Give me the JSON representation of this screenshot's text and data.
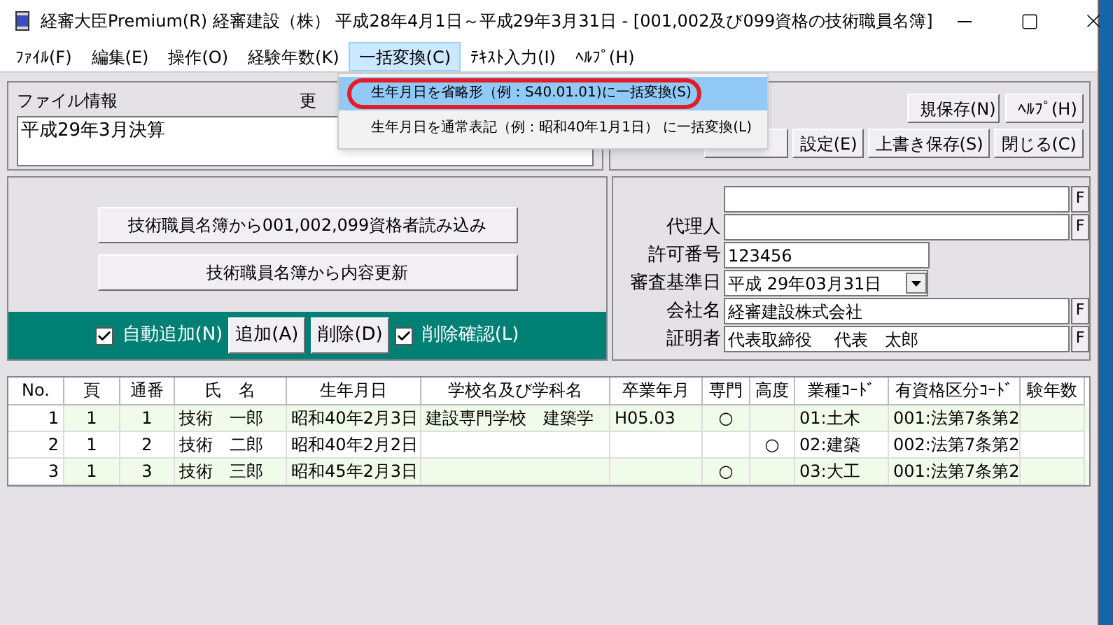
{
  "window": {
    "title": "経審大臣Premium(R)  経審建設（株）   平成28年4月1日～平成29年3月31日 - [001,002及び099資格の技術職員名簿]"
  },
  "menu": [
    {
      "label": "ﾌｧｲﾙ(F)",
      "selected": false
    },
    {
      "label": "編集(E)",
      "selected": false
    },
    {
      "label": "操作(O)",
      "selected": false
    },
    {
      "label": "経験年数(K)",
      "selected": false
    },
    {
      "label": "一括変換(C)",
      "selected": true
    },
    {
      "label": "ﾃｷｽﾄ入力(I)",
      "selected": false
    },
    {
      "label": "ﾍﾙﾌﾟ(H)",
      "selected": false
    }
  ],
  "dropdown": [
    {
      "label": "生年月日を省略形（例：S40.01.01)に一括変換(S)",
      "selected": true,
      "circled": true
    },
    {
      "label": "生年月日を通常表記（例：昭和40年1月1日） に一括変換(L)",
      "selected": false,
      "circled": false
    }
  ],
  "file_info": {
    "label": "ファイル情報",
    "side_label": "更",
    "value": "平成29年3月決算"
  },
  "top_buttons": [
    [
      "規保存(N)",
      "ﾍﾙﾌﾟ(H)"
    ],
    [
      "設定(E)",
      "上書き保存(S)",
      "閉じる(C)"
    ]
  ],
  "load_buttons": [
    "技術職員名簿から001,002,099資格者読み込み",
    "技術職員名簿から内容更新"
  ],
  "action_bar": [
    {
      "kind": "checkbox",
      "label": "自動追加(N)",
      "checked": true
    },
    {
      "kind": "button",
      "label": "追加(A)"
    },
    {
      "kind": "button",
      "label": "削除(D)"
    },
    {
      "kind": "checkbox",
      "label": "削除確認(L)",
      "checked": true
    }
  ],
  "form": [
    {
      "kind": "text",
      "f_button": "F"
    },
    {
      "kind": "text",
      "label": "代理人",
      "f_button": "F"
    },
    {
      "kind": "short",
      "label": "許可番号",
      "value": "123456"
    },
    {
      "kind": "date",
      "label": "審査基準日",
      "value": "平成 29年03月31日"
    },
    {
      "kind": "text",
      "label": "会社名",
      "value": "経審建設株式会社",
      "f_button": "F"
    },
    {
      "kind": "text",
      "label": "証明者",
      "value": "代表取締役　 代表　太郎",
      "f_button": "F"
    }
  ],
  "table": {
    "columns": [
      "No.",
      "頁",
      "通番",
      "氏　名",
      "生年月日",
      "学校名及び学科名",
      "卒業年月",
      "専門",
      "高度",
      "業種ｺｰﾄﾞ",
      "有資格区分ｺｰﾄﾞ",
      "験年数"
    ],
    "rows": [
      {
        "shaded": true,
        "cells": [
          "1",
          "1",
          "1",
          "技術　一郎",
          "昭和40年2月3日",
          "建設専門学校　建築学",
          "H05.03",
          "○",
          "",
          "01:土木",
          "001:法第7条第2",
          ""
        ]
      },
      {
        "shaded": false,
        "cells": [
          "2",
          "1",
          "2",
          "技術　二郎",
          "昭和40年2月2日",
          "",
          "",
          "",
          "○",
          "02:建築",
          "002:法第7条第2",
          ""
        ]
      },
      {
        "shaded": true,
        "cells": [
          "3",
          "1",
          "3",
          "技術　三郎",
          "昭和45年2月3日",
          "",
          "",
          "○",
          "",
          "03:大工",
          "001:法第7条第2",
          ""
        ]
      }
    ]
  }
}
